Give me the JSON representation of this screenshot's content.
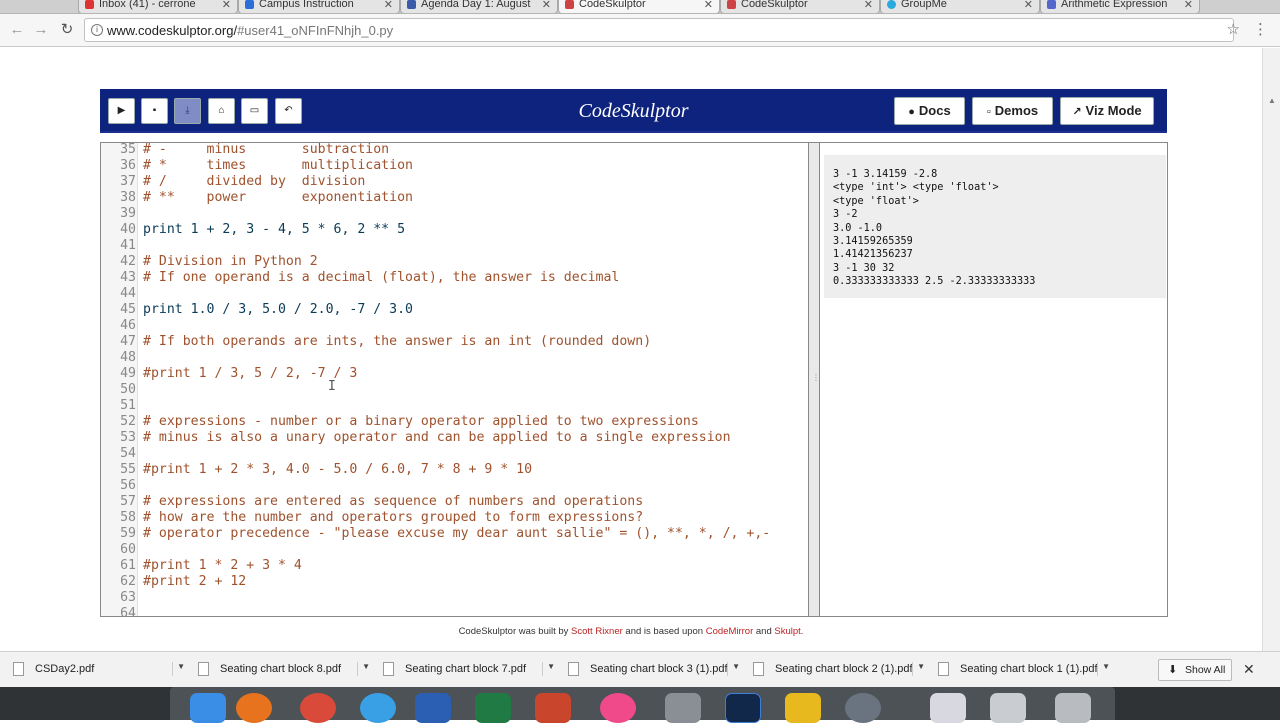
{
  "browser": {
    "tabs": [
      {
        "label": "Inbox (41) - cerrone",
        "active": false
      },
      {
        "label": "Campus Instruction",
        "active": false
      },
      {
        "label": "Agenda Day 1: August",
        "active": false
      },
      {
        "label": "CodeSkulptor",
        "active": true
      },
      {
        "label": "CodeSkulptor",
        "active": false
      },
      {
        "label": "GroupMe",
        "active": false
      },
      {
        "label": "Arithmetic Expression",
        "active": false
      }
    ],
    "url_host": "www.codeskulptor.org/",
    "url_path": "#user41_oNFInFNhjh_0.py"
  },
  "header": {
    "title": "CodeSkulptor",
    "docs_label": "Docs",
    "demos_label": "Demos",
    "viz_label": "Viz Mode"
  },
  "editor": {
    "lines": [
      {
        "num": "35",
        "text": "# -     minus       subtraction",
        "kind": "comment"
      },
      {
        "num": "36",
        "text": "# *     times       multiplication",
        "kind": "comment"
      },
      {
        "num": "37",
        "text": "# /     divided by  division",
        "kind": "comment"
      },
      {
        "num": "38",
        "text": "# **    power       exponentiation",
        "kind": "comment"
      },
      {
        "num": "39",
        "text": "",
        "kind": "stmt"
      },
      {
        "num": "40",
        "text": "print 1 + 2, 3 - 4, 5 * 6, 2 ** 5",
        "kind": "stmt"
      },
      {
        "num": "41",
        "text": "",
        "kind": "stmt"
      },
      {
        "num": "42",
        "text": "# Division in Python 2",
        "kind": "comment"
      },
      {
        "num": "43",
        "text": "# If one operand is a decimal (float), the answer is decimal",
        "kind": "comment"
      },
      {
        "num": "44",
        "text": "",
        "kind": "stmt"
      },
      {
        "num": "45",
        "text": "print 1.0 / 3, 5.0 / 2.0, -7 / 3.0",
        "kind": "stmt"
      },
      {
        "num": "46",
        "text": "",
        "kind": "stmt"
      },
      {
        "num": "47",
        "text": "# If both operands are ints, the answer is an int (rounded down)",
        "kind": "comment"
      },
      {
        "num": "48",
        "text": "",
        "kind": "stmt"
      },
      {
        "num": "49",
        "text": "#print 1 / 3, 5 / 2, -7 / 3",
        "kind": "comment"
      },
      {
        "num": "50",
        "text": "",
        "kind": "stmt"
      },
      {
        "num": "51",
        "text": "",
        "kind": "stmt"
      },
      {
        "num": "52",
        "text": "# expressions - number or a binary operator applied to two expressions",
        "kind": "comment"
      },
      {
        "num": "53",
        "text": "# minus is also a unary operator and can be applied to a single expression",
        "kind": "comment"
      },
      {
        "num": "54",
        "text": "",
        "kind": "stmt"
      },
      {
        "num": "55",
        "text": "#print 1 + 2 * 3, 4.0 - 5.0 / 6.0, 7 * 8 + 9 * 10",
        "kind": "comment"
      },
      {
        "num": "56",
        "text": "",
        "kind": "stmt"
      },
      {
        "num": "57",
        "text": "# expressions are entered as sequence of numbers and operations",
        "kind": "comment"
      },
      {
        "num": "58",
        "text": "# how are the number and operators grouped to form expressions?",
        "kind": "comment"
      },
      {
        "num": "59",
        "text": "# operator precedence - \"please excuse my dear aunt sallie\" = (), **, *, /, +,-",
        "kind": "comment"
      },
      {
        "num": "60",
        "text": "",
        "kind": "stmt"
      },
      {
        "num": "61",
        "text": "#print 1 * 2 + 3 * 4",
        "kind": "comment"
      },
      {
        "num": "62",
        "text": "#print 2 + 12",
        "kind": "comment"
      },
      {
        "num": "63",
        "text": "",
        "kind": "stmt"
      },
      {
        "num": "64",
        "text": "",
        "kind": "stmt"
      }
    ]
  },
  "output": {
    "lines": [
      "3 -1 3.14159 -2.8",
      "<type 'int'> <type 'float'>",
      "<type 'float'>",
      "3 -2",
      "3.0 -1.0",
      "3.14159265359",
      "1.41421356237",
      "3 -1 30 32",
      "0.333333333333 2.5 -2.33333333333"
    ]
  },
  "footer": {
    "prefix": "CodeSkulptor was built by ",
    "author": "Scott Rixner",
    "middle": " and is based upon ",
    "lib1": "CodeMirror",
    "and": " and ",
    "lib2": "Skulpt",
    "suffix": "."
  },
  "downloads": {
    "items": [
      "CSDay2.pdf",
      "Seating chart block 8.pdf",
      "Seating chart block 7.pdf",
      "Seating chart block 3 (1).pdf",
      "Seating chart block 2 (1).pdf",
      "Seating chart block 1 (1).pdf"
    ],
    "show_all": "Show All"
  },
  "colors": {
    "header_bg": "#0e237d",
    "comment": "#a0522d",
    "statement": "#0a3b57",
    "link": "#b22222"
  }
}
